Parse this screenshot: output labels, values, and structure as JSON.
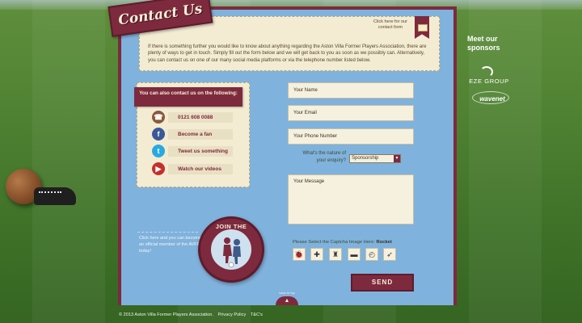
{
  "header": {
    "title": "Contact Us",
    "form_link": "Click here for our contact form",
    "intro": "If there is something further you would like to know about anything regarding the Aston Villa Former Players Association, there are plenty of ways to get in touch. Simply fill out the form below and we will get back to you as soon as we possibly can. Alternatively, you can contact us on one of our many social media platforms or via the telephone number listed below."
  },
  "social": {
    "heading": "You can also contact us on the following:",
    "items": [
      {
        "icon": "phone-icon",
        "label": "0121 608 0088",
        "color": "#8a5a3a"
      },
      {
        "icon": "facebook-icon",
        "label": "Become a fan",
        "color": "#3b5998"
      },
      {
        "icon": "twitter-icon",
        "label": "Tweet us something",
        "color": "#2aa9e0"
      },
      {
        "icon": "youtube-icon",
        "label": "Watch our videos",
        "color": "#c4302b"
      }
    ]
  },
  "join": {
    "text": "Click here and you can become an official member of the AVFPA today!",
    "badge": "JOIN THE AVFPA"
  },
  "form": {
    "name_placeholder": "Your Name",
    "email_placeholder": "Email",
    "email_display": "Your Email",
    "phone_placeholder": "Your Phone Number",
    "enquiry_label": "What's the nature of your enquiry?",
    "enquiry_value": "Sponsorship",
    "message_placeholder": "Your Message",
    "captcha_label": "Please Select the Captcha Image Here:",
    "captcha_answer": "Rocket",
    "captcha_icons": [
      "bug-icon",
      "puzzle-icon",
      "trophy-icon",
      "truck-icon",
      "clock-icon",
      "rocket-icon"
    ],
    "send_label": "SEND"
  },
  "back_to_top": "back to top",
  "sponsors": {
    "title": "Meet our sponsors",
    "logos": [
      "EZE GROUP",
      "wavenet"
    ]
  },
  "footer": {
    "copyright": "© 2013 Aston Villa Former Players Association.",
    "privacy": "Privacy Policy",
    "terms": "T&C's"
  },
  "colors": {
    "accent": "#7e2a3e",
    "panel": "#7fb2dd",
    "cream": "#f3ecd3"
  }
}
